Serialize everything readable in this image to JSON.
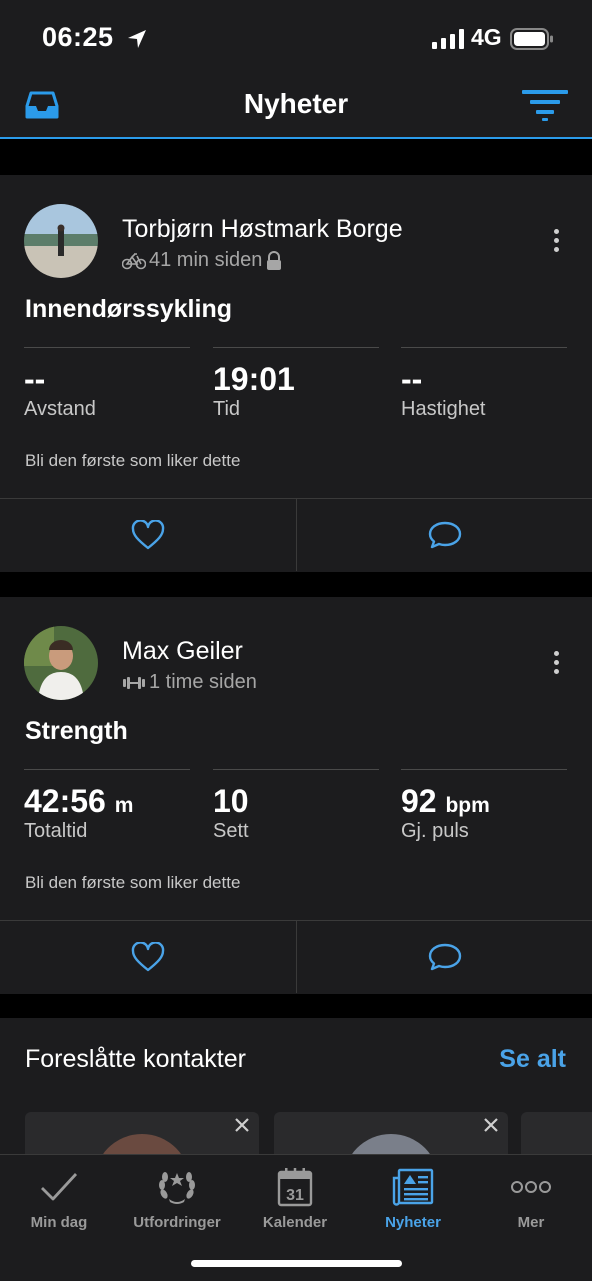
{
  "status": {
    "time": "06:25",
    "network": "4G"
  },
  "nav": {
    "title": "Nyheter"
  },
  "posts": [
    {
      "name": "Torbjørn Høstmark Borge",
      "time": "41 min siden",
      "activity_icon": "bike-icon",
      "private": true,
      "title": "Innendørssykling",
      "stats": [
        {
          "value": "--",
          "unit": "",
          "label": "Avstand"
        },
        {
          "value": "19:01",
          "unit": "",
          "label": "Tid"
        },
        {
          "value": "--",
          "unit": "",
          "label": "Hastighet"
        }
      ],
      "likes_text": "Bli den første som liker dette"
    },
    {
      "name": "Max Geiler",
      "time": "1 time siden",
      "activity_icon": "dumbbell-icon",
      "private": false,
      "title": "Strength",
      "stats": [
        {
          "value": "42:56",
          "unit": "m",
          "label": "Totaltid"
        },
        {
          "value": "10",
          "unit": "",
          "label": "Sett"
        },
        {
          "value": "92",
          "unit": "bpm",
          "label": "Gj. puls"
        }
      ],
      "likes_text": "Bli den første som liker dette"
    }
  ],
  "suggested": {
    "heading": "Foreslåtte kontakter",
    "see_all": "Se alt"
  },
  "tabs": [
    {
      "label": "Min dag",
      "icon": "check-icon"
    },
    {
      "label": "Utfordringer",
      "icon": "laurel-icon"
    },
    {
      "label": "Kalender",
      "icon": "calendar-icon",
      "day": "31"
    },
    {
      "label": "Nyheter",
      "icon": "newsfeed-icon",
      "active": true
    },
    {
      "label": "Mer",
      "icon": "more-icon"
    }
  ],
  "colors": {
    "accent": "#4aa3e8",
    "card": "#1c1c1e",
    "background": "#000000"
  }
}
